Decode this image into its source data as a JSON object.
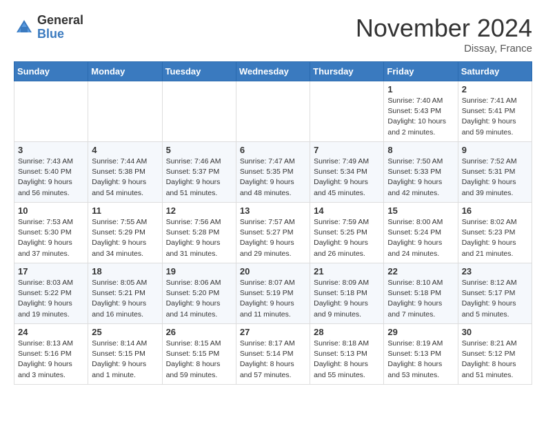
{
  "logo": {
    "general": "General",
    "blue": "Blue"
  },
  "header": {
    "month": "November 2024",
    "location": "Dissay, France"
  },
  "weekdays": [
    "Sunday",
    "Monday",
    "Tuesday",
    "Wednesday",
    "Thursday",
    "Friday",
    "Saturday"
  ],
  "weeks": [
    [
      {
        "day": "",
        "info": ""
      },
      {
        "day": "",
        "info": ""
      },
      {
        "day": "",
        "info": ""
      },
      {
        "day": "",
        "info": ""
      },
      {
        "day": "",
        "info": ""
      },
      {
        "day": "1",
        "info": "Sunrise: 7:40 AM\nSunset: 5:43 PM\nDaylight: 10 hours\nand 2 minutes."
      },
      {
        "day": "2",
        "info": "Sunrise: 7:41 AM\nSunset: 5:41 PM\nDaylight: 9 hours\nand 59 minutes."
      }
    ],
    [
      {
        "day": "3",
        "info": "Sunrise: 7:43 AM\nSunset: 5:40 PM\nDaylight: 9 hours\nand 56 minutes."
      },
      {
        "day": "4",
        "info": "Sunrise: 7:44 AM\nSunset: 5:38 PM\nDaylight: 9 hours\nand 54 minutes."
      },
      {
        "day": "5",
        "info": "Sunrise: 7:46 AM\nSunset: 5:37 PM\nDaylight: 9 hours\nand 51 minutes."
      },
      {
        "day": "6",
        "info": "Sunrise: 7:47 AM\nSunset: 5:35 PM\nDaylight: 9 hours\nand 48 minutes."
      },
      {
        "day": "7",
        "info": "Sunrise: 7:49 AM\nSunset: 5:34 PM\nDaylight: 9 hours\nand 45 minutes."
      },
      {
        "day": "8",
        "info": "Sunrise: 7:50 AM\nSunset: 5:33 PM\nDaylight: 9 hours\nand 42 minutes."
      },
      {
        "day": "9",
        "info": "Sunrise: 7:52 AM\nSunset: 5:31 PM\nDaylight: 9 hours\nand 39 minutes."
      }
    ],
    [
      {
        "day": "10",
        "info": "Sunrise: 7:53 AM\nSunset: 5:30 PM\nDaylight: 9 hours\nand 37 minutes."
      },
      {
        "day": "11",
        "info": "Sunrise: 7:55 AM\nSunset: 5:29 PM\nDaylight: 9 hours\nand 34 minutes."
      },
      {
        "day": "12",
        "info": "Sunrise: 7:56 AM\nSunset: 5:28 PM\nDaylight: 9 hours\nand 31 minutes."
      },
      {
        "day": "13",
        "info": "Sunrise: 7:57 AM\nSunset: 5:27 PM\nDaylight: 9 hours\nand 29 minutes."
      },
      {
        "day": "14",
        "info": "Sunrise: 7:59 AM\nSunset: 5:25 PM\nDaylight: 9 hours\nand 26 minutes."
      },
      {
        "day": "15",
        "info": "Sunrise: 8:00 AM\nSunset: 5:24 PM\nDaylight: 9 hours\nand 24 minutes."
      },
      {
        "day": "16",
        "info": "Sunrise: 8:02 AM\nSunset: 5:23 PM\nDaylight: 9 hours\nand 21 minutes."
      }
    ],
    [
      {
        "day": "17",
        "info": "Sunrise: 8:03 AM\nSunset: 5:22 PM\nDaylight: 9 hours\nand 19 minutes."
      },
      {
        "day": "18",
        "info": "Sunrise: 8:05 AM\nSunset: 5:21 PM\nDaylight: 9 hours\nand 16 minutes."
      },
      {
        "day": "19",
        "info": "Sunrise: 8:06 AM\nSunset: 5:20 PM\nDaylight: 9 hours\nand 14 minutes."
      },
      {
        "day": "20",
        "info": "Sunrise: 8:07 AM\nSunset: 5:19 PM\nDaylight: 9 hours\nand 11 minutes."
      },
      {
        "day": "21",
        "info": "Sunrise: 8:09 AM\nSunset: 5:18 PM\nDaylight: 9 hours\nand 9 minutes."
      },
      {
        "day": "22",
        "info": "Sunrise: 8:10 AM\nSunset: 5:18 PM\nDaylight: 9 hours\nand 7 minutes."
      },
      {
        "day": "23",
        "info": "Sunrise: 8:12 AM\nSunset: 5:17 PM\nDaylight: 9 hours\nand 5 minutes."
      }
    ],
    [
      {
        "day": "24",
        "info": "Sunrise: 8:13 AM\nSunset: 5:16 PM\nDaylight: 9 hours\nand 3 minutes."
      },
      {
        "day": "25",
        "info": "Sunrise: 8:14 AM\nSunset: 5:15 PM\nDaylight: 9 hours\nand 1 minute."
      },
      {
        "day": "26",
        "info": "Sunrise: 8:15 AM\nSunset: 5:15 PM\nDaylight: 8 hours\nand 59 minutes."
      },
      {
        "day": "27",
        "info": "Sunrise: 8:17 AM\nSunset: 5:14 PM\nDaylight: 8 hours\nand 57 minutes."
      },
      {
        "day": "28",
        "info": "Sunrise: 8:18 AM\nSunset: 5:13 PM\nDaylight: 8 hours\nand 55 minutes."
      },
      {
        "day": "29",
        "info": "Sunrise: 8:19 AM\nSunset: 5:13 PM\nDaylight: 8 hours\nand 53 minutes."
      },
      {
        "day": "30",
        "info": "Sunrise: 8:21 AM\nSunset: 5:12 PM\nDaylight: 8 hours\nand 51 minutes."
      }
    ]
  ]
}
